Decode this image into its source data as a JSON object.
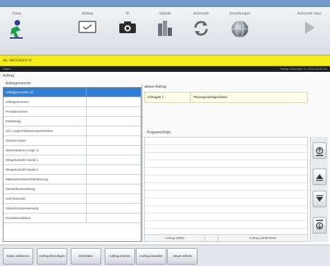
{
  "toolbar": {
    "items": [
      {
        "label": "Home",
        "icon": "runner-logo-icon"
      },
      {
        "label": "Auftrag",
        "icon": "order-card-icon"
      },
      {
        "label": "ID",
        "icon": "camera-icon"
      },
      {
        "label": "Statistik",
        "icon": "bar-chart-icon"
      },
      {
        "label": "Automatik",
        "icon": "sync-icon"
      },
      {
        "label": "Einstellungen",
        "icon": "globe-icon"
      },
      {
        "label": "Automatik Start",
        "icon": "play-icon"
      }
    ]
  },
  "yellowbar": {
    "text": "AE: MEISSNER W"
  },
  "statusbar": {
    "left": "Status",
    "right": "Freitag, November 21, 2014 15:45 Uhr"
  },
  "section": {
    "title": "Auftrag",
    "list_header": "Auftragsnummer",
    "active_title": "aktiver Auftrag",
    "program_title": "Programmfolge"
  },
  "list": {
    "rows": [
      {
        "label": "Auftragsnummer (1)",
        "value": "",
        "selected": true
      },
      {
        "label": "Auftragsnummer",
        "value": ""
      },
      {
        "label": "Produktnummer",
        "value": ""
      },
      {
        "label": "Palettentyp",
        "value": ""
      },
      {
        "label": "Anz. Lagen/Verpackungseinheiten",
        "value": ""
      },
      {
        "label": "Gesamt Kisten",
        "value": ""
      },
      {
        "label": "Spitzenkartons (Lage 1)",
        "value": ""
      },
      {
        "label": "Wiegekontrolle Modul 1",
        "value": ""
      },
      {
        "label": "Wiegekontrolle Modul 2",
        "value": ""
      },
      {
        "label": "Materialnachweis/Etikettierung",
        "value": ""
      },
      {
        "label": "Muster/Rückmeldung",
        "value": ""
      },
      {
        "label": "Soll-Stückzahl",
        "value": ""
      },
      {
        "label": "Verpackungsanweisung",
        "value": ""
      },
      {
        "label": "Produktionsdatum",
        "value": ""
      }
    ]
  },
  "active": {
    "id": "Auftrag/ID 1",
    "status": "Planung/Aufträge/Ablauf"
  },
  "program_footer": {
    "col1": "Auftrag Zähler",
    "col2": "Auftrag Zähler/Wert"
  },
  "bottom_buttons": [
    {
      "label": "Daten aktivieren"
    },
    {
      "label": "Auftrag hinzufügen"
    },
    {
      "label": "Info/Daten"
    },
    {
      "label": "Auftrag löschen"
    },
    {
      "label": "Auftrag beenden"
    },
    {
      "label": "Neues Etikett"
    }
  ],
  "colors": {
    "yellow": "#f7ec1a",
    "selection": "#2f7fd6",
    "titlebar": "#6f9ac9"
  }
}
